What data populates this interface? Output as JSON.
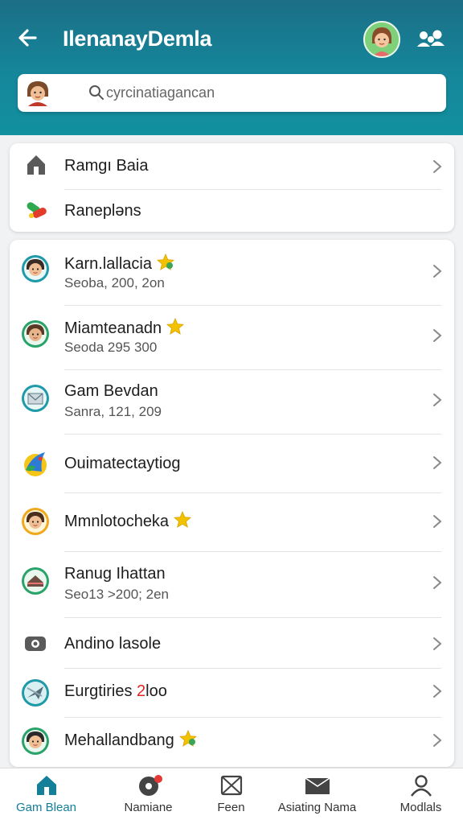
{
  "header": {
    "title": "IlenanayDemla",
    "accent": "#15879b"
  },
  "search": {
    "placeholder": "cyrcinatiagancan"
  },
  "quick_links": [
    {
      "label": "Ramgı Baia",
      "icon": "home-icon"
    },
    {
      "label": "Ranepləns",
      "icon": "pills-icon"
    }
  ],
  "contacts": [
    {
      "name": "Karn.lallacia",
      "detail": "Seoba, 200, 2on",
      "icon": "avatar-icon",
      "star": true
    },
    {
      "name": "Miamteanadn",
      "detail": "Seoda 295 300",
      "icon": "avatar-icon",
      "star": true
    },
    {
      "name": "Gam Bevdan",
      "detail": "Sanra, 121, 209",
      "icon": "mail-icon",
      "star": false
    },
    {
      "name": "Ouimatectaytiog",
      "detail": "",
      "icon": "game-icon",
      "star": false
    },
    {
      "name": "Mmnlotocheka",
      "detail": "",
      "icon": "avatar-icon",
      "star": true
    },
    {
      "name": "Ranug Ihattan",
      "detail": "Seo13 >200; 2en",
      "icon": "cake-icon",
      "star": false
    },
    {
      "name": "Andino lasole",
      "detail": "",
      "icon": "camera-icon",
      "star": false
    },
    {
      "name": "Eurgtiries ",
      "name_highlight": "2",
      "name_tail": "loo",
      "detail": "",
      "icon": "plane-icon",
      "star": false
    },
    {
      "name": "Mehallandbang",
      "detail": "",
      "icon": "avatar-icon",
      "star": true
    }
  ],
  "bottom_nav": [
    {
      "label": "Gam Blean",
      "icon": "home-icon",
      "active": true
    },
    {
      "label": "Namiane",
      "icon": "camera-icon",
      "active": false,
      "badge": true
    },
    {
      "label": "Feen",
      "icon": "mail-icon",
      "active": false
    },
    {
      "label": "Asiating Nama",
      "icon": "folder-icon",
      "active": false
    },
    {
      "label": "Modlals",
      "icon": "person-icon",
      "active": false
    }
  ]
}
